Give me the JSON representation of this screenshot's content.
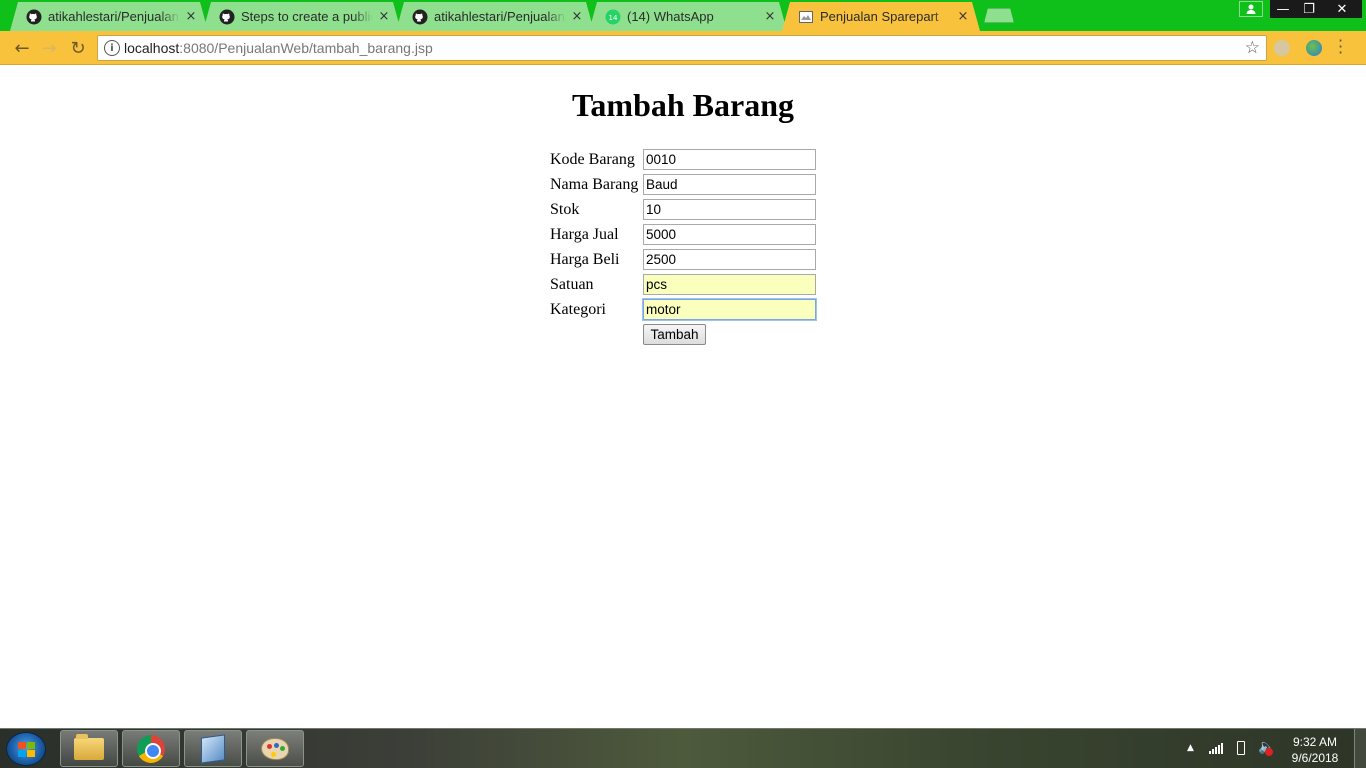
{
  "browser": {
    "tabs": [
      {
        "title": "atikahlestari/PenjualanSp",
        "favicon": "github-icon",
        "close": "×"
      },
      {
        "title": "Steps to create a public g",
        "favicon": "github-icon",
        "close": "×"
      },
      {
        "title": "atikahlestari/PenjualanSp",
        "favicon": "github-icon",
        "close": "×"
      },
      {
        "title": "(14) WhatsApp",
        "favicon": "whatsapp-icon",
        "badge": "14",
        "close": "×"
      },
      {
        "title": "Penjualan Sparepart",
        "favicon": "page-icon",
        "close": "×",
        "active": true
      }
    ],
    "window_controls": {
      "minimize": "—",
      "maximize": "❐",
      "close": "✕"
    },
    "address": {
      "host": "localhost",
      "rest": ":8080/PenjualanWeb/tambah_barang.jsp"
    },
    "colors": {
      "tabstrip": "#0fbf1a",
      "active_tab": "#f9c23c",
      "inactive_tab": "#8ee08e",
      "toolbar": "#f9c23c"
    }
  },
  "page": {
    "title": "Tambah Barang",
    "fields": [
      {
        "label": "Kode Barang",
        "value": "0010"
      },
      {
        "label": "Nama Barang",
        "value": "Baud"
      },
      {
        "label": "Stok",
        "value": "10"
      },
      {
        "label": "Harga Jual",
        "value": "5000"
      },
      {
        "label": "Harga Beli",
        "value": "2500"
      },
      {
        "label": "Satuan",
        "value": "pcs"
      },
      {
        "label": "Kategori",
        "value": "motor"
      }
    ],
    "submit_label": "Tambah"
  },
  "taskbar": {
    "apps": [
      "file-explorer-icon",
      "chrome-icon",
      "virtualbox-icon",
      "paint-icon"
    ],
    "clock": {
      "time": "9:32 AM",
      "date": "9/6/2018"
    }
  }
}
